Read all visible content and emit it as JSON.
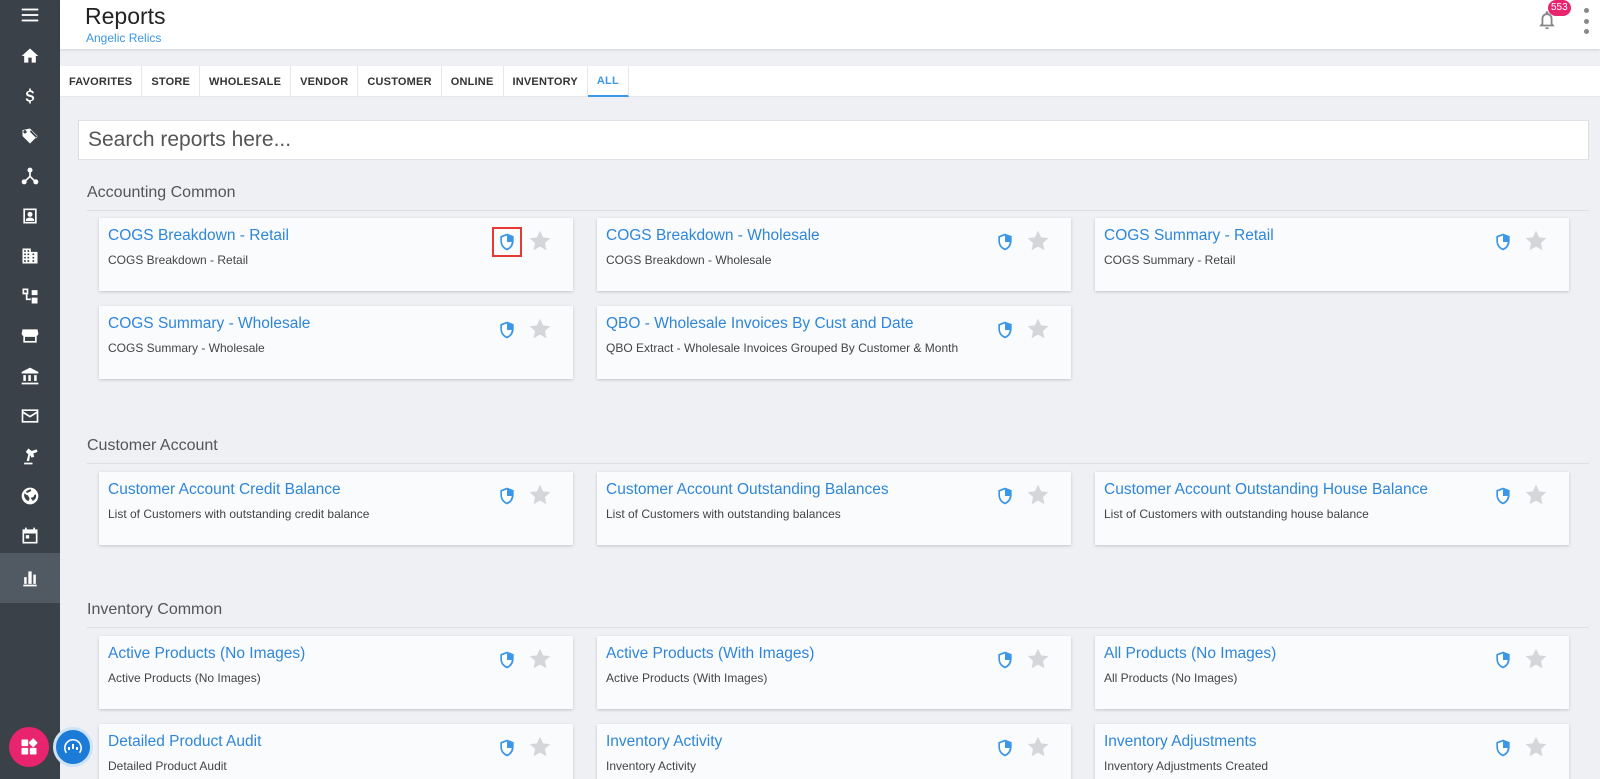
{
  "header": {
    "title": "Reports",
    "subtitle": "Angelic Relics",
    "notification_count": "553"
  },
  "sidebar": {
    "items": [
      {
        "icon": "menu-icon"
      },
      {
        "icon": "home-icon"
      },
      {
        "icon": "dollar-icon"
      },
      {
        "icon": "tags-icon"
      },
      {
        "icon": "network-icon"
      },
      {
        "icon": "contact-card-icon"
      },
      {
        "icon": "building-icon"
      },
      {
        "icon": "hierarchy-icon"
      },
      {
        "icon": "storefront-icon"
      },
      {
        "icon": "bank-icon"
      },
      {
        "icon": "mail-icon"
      },
      {
        "icon": "robot-arm-icon"
      },
      {
        "icon": "globe-icon"
      },
      {
        "icon": "calendar-icon"
      },
      {
        "icon": "bar-chart-icon",
        "active": true
      }
    ]
  },
  "tabs": [
    "FAVORITES",
    "STORE",
    "WHOLESALE",
    "VENDOR",
    "CUSTOMER",
    "ONLINE",
    "INVENTORY",
    "ALL"
  ],
  "active_tab": "ALL",
  "search": {
    "placeholder": "Search reports here..."
  },
  "sections": [
    {
      "title": "Accounting Common",
      "cards": [
        {
          "title": "COGS Breakdown - Retail",
          "desc": "COGS Breakdown - Retail"
        },
        {
          "title": "COGS Breakdown - Wholesale",
          "desc": "COGS Breakdown - Wholesale"
        },
        {
          "title": "COGS Summary - Retail",
          "desc": "COGS Summary - Retail"
        },
        {
          "title": "COGS Summary - Wholesale",
          "desc": "COGS Summary - Wholesale"
        },
        {
          "title": "QBO - Wholesale Invoices By Cust and Date",
          "desc": "QBO Extract - Wholesale Invoices Grouped By Customer & Month"
        }
      ]
    },
    {
      "title": "Customer Account",
      "cards": [
        {
          "title": "Customer Account Credit Balance",
          "desc": "List of Customers with outstanding credit balance"
        },
        {
          "title": "Customer Account Outstanding Balances",
          "desc": "List of Customers with outstanding balances"
        },
        {
          "title": "Customer Account Outstanding House Balance",
          "desc": "List of Customers with outstanding house balance"
        }
      ]
    },
    {
      "title": "Inventory Common",
      "cards": [
        {
          "title": "Active Products (No Images)",
          "desc": "Active Products (No Images)"
        },
        {
          "title": "Active Products (With Images)",
          "desc": "Active Products (With Images)"
        },
        {
          "title": "All Products (No Images)",
          "desc": "All Products (No Images)"
        },
        {
          "title": "Detailed Product Audit",
          "desc": "Detailed Product Audit"
        },
        {
          "title": "Inventory Activity",
          "desc": "Inventory Activity"
        },
        {
          "title": "Inventory Adjustments",
          "desc": "Inventory Adjustments Created"
        }
      ]
    }
  ],
  "colors": {
    "sidebar": "#3a4149",
    "accent": "#3b97e8",
    "badge": "#e8246f",
    "shield": "#3b97e8",
    "star": "#d4d6da",
    "highlight": "#e53935"
  }
}
